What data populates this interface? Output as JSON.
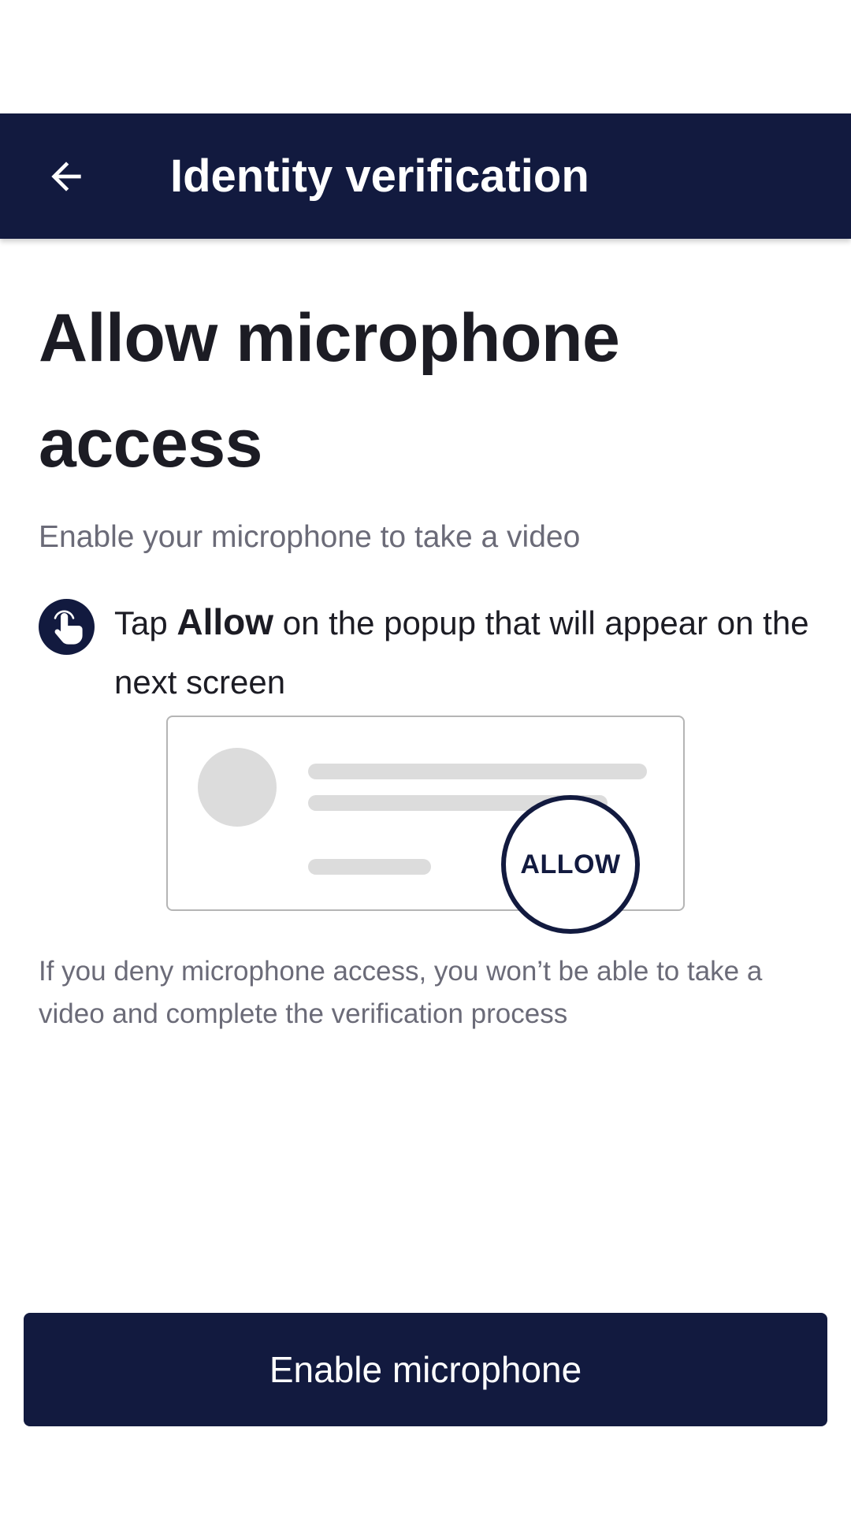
{
  "app_bar": {
    "title": "Identity verification",
    "back_icon": "arrow-left-icon",
    "background": "#121a3f"
  },
  "main": {
    "heading": "Allow microphone access",
    "subtitle": "Enable your microphone to take a video",
    "instruction": {
      "icon": "tap-hand-icon",
      "prefix": "Tap ",
      "emphasis": "Allow",
      "suffix": " on the popup that will appear on the next screen"
    },
    "illustration": {
      "allow_label": "ALLOW"
    },
    "warning": "If you deny microphone access, you won’t be able to take a video and complete the verification process"
  },
  "footer": {
    "primary_button_label": "Enable microphone"
  },
  "colors": {
    "brand_navy": "#121a3f",
    "heading_text": "#1c1c24",
    "secondary_text": "#6b6b78",
    "placeholder_gray": "#dcdcdc"
  }
}
